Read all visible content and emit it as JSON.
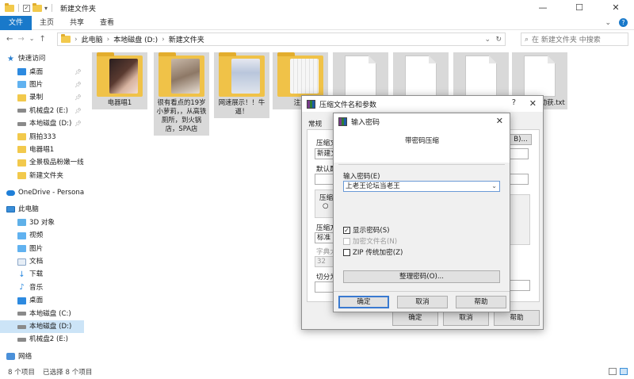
{
  "explorer": {
    "window_title": "新建文件夹",
    "controls": {
      "minimize": "—",
      "maximize": "☐",
      "close": "✕"
    },
    "ribbon_tabs": [
      "文件",
      "主页",
      "共享",
      "查看"
    ],
    "address": {
      "crumbs": [
        "此电脑",
        "本地磁盘 (D:)",
        "新建文件夹"
      ]
    },
    "search_placeholder": "在 新建文件夹 中搜索",
    "sidebar": {
      "quick_access": "快速访问",
      "quick_items": [
        "桌面",
        "图片",
        "录制",
        "机械盘2 (E:)",
        "本地磁盘 (D:)",
        "厕拍333",
        "电器唱1",
        "全景极品粉嫩一线天",
        "新建文件夹"
      ],
      "onedrive": "OneDrive - Persona",
      "this_pc": "此电脑",
      "pc_items": [
        "3D 对象",
        "视频",
        "图片",
        "文档",
        "下载",
        "音乐",
        "桌面",
        "本地磁盘 (C:)",
        "本地磁盘 (D:)",
        "机械盘2 (E:)"
      ],
      "network": "网络"
    },
    "items": [
      {
        "name": "电器唱1"
      },
      {
        "name": "很有看点的19岁小萝莉，，从高铁厕所，到火锅店，SPA店"
      },
      {
        "name": "网速展示！！牛逼！"
      },
      {
        "name": "注意"
      },
      {
        "name": ""
      },
      {
        "name": ""
      },
      {
        "name": ""
      },
      {
        "name": "及APP自动获.txt"
      }
    ],
    "status": {
      "count": "8 个项目",
      "selected": "已选择 8 个项目"
    }
  },
  "archive_dialog": {
    "title": "压缩文件名和参数",
    "help": "?",
    "close": "✕",
    "tab_general": "常规",
    "label_archive": "压缩文",
    "archive_value": "新建文",
    "browse": "B)...",
    "label_default": "默认配",
    "label_format": "压缩",
    "label_method": "压缩方",
    "method_value": "标准",
    "label_dict": "字典大",
    "dict_value": "32",
    "label_split": "切分为",
    "ok": "确定",
    "cancel": "取消",
    "help_btn": "帮助"
  },
  "password_dialog": {
    "title": "输入密码",
    "close": "✕",
    "heading": "带密码压缩",
    "field_label": "输入密码(E)",
    "password_value": "上老王论坛当老王",
    "show_password": "显示密码(S)",
    "encrypt_names": "加密文件名(N)",
    "zip_legacy": "ZIP 传统加密(Z)",
    "organize": "整理密码(O)...",
    "ok": "确定",
    "cancel": "取消",
    "help": "帮助"
  }
}
